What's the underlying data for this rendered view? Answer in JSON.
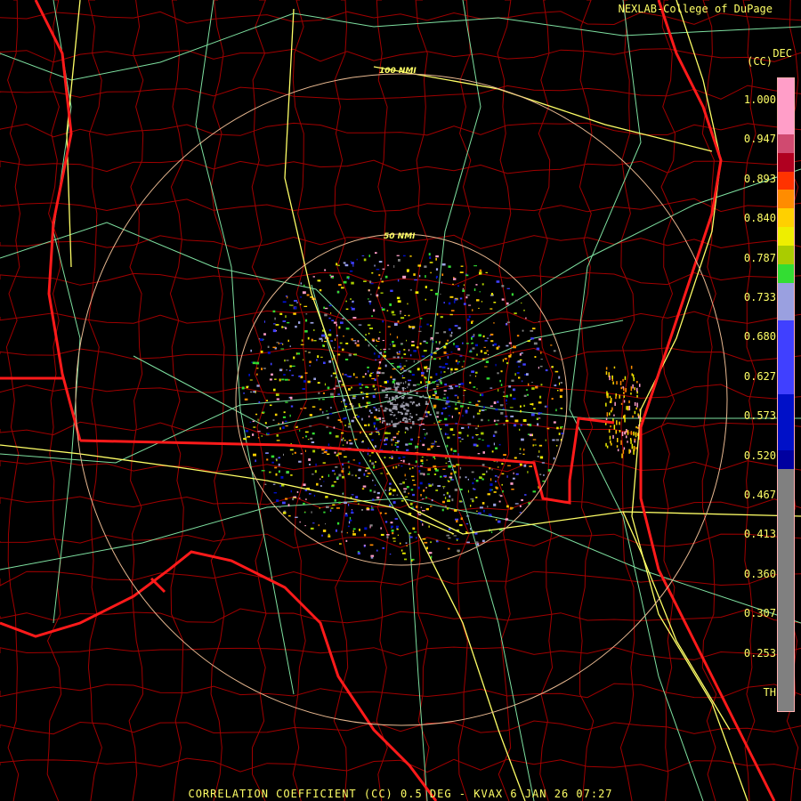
{
  "header": {
    "credit": "NEXLAB-College of DuPage"
  },
  "legend": {
    "title_top": "DEC",
    "title_unit": "(CC)",
    "ticks": [
      "1.000",
      "0.947",
      "0.893",
      "0.840",
      "0.787",
      "0.733",
      "0.680",
      "0.627",
      "0.573",
      "0.520",
      "0.467",
      "0.413",
      "0.360",
      "0.307",
      "0.253",
      "TH"
    ],
    "colors": [
      "#ff9ec8",
      "#d04a70",
      "#b00020",
      "#ff3300",
      "#ff8c00",
      "#ffd000",
      "#eeee00",
      "#aacc00",
      "#33dd33",
      "#9aa0e0",
      "#4040ff",
      "#0010c8",
      "#0000a0",
      "#808080"
    ]
  },
  "map": {
    "rings": [
      "50 NMI",
      "100 NMI"
    ],
    "colors": {
      "state_border": "#ff1a1a",
      "county_line": "#a00000",
      "highway": "#ffff66",
      "road": "#7ee0a0",
      "range_ring": "#e8b890"
    }
  },
  "footer": {
    "caption": "CORRELATION COEFFICIENT (CC) 0.5 DEG - KVAX 6 JAN 26 07:27"
  }
}
